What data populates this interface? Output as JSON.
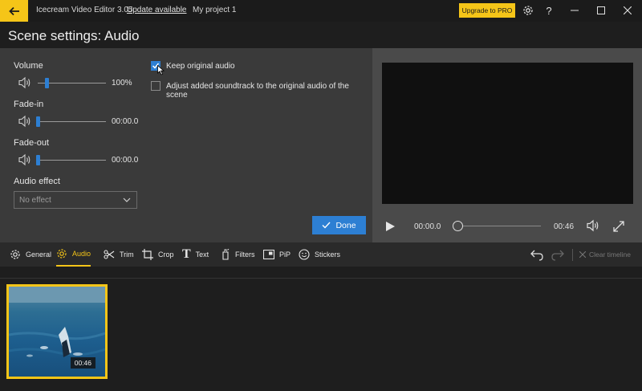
{
  "titlebar": {
    "app_title": "Icecream Video Editor 3.05",
    "update_link": "Update available",
    "project_name": "My project 1",
    "upgrade_label": "Upgrade to PRO"
  },
  "page_title": "Scene settings: Audio",
  "audio": {
    "volume_label": "Volume",
    "volume_value": "100%",
    "volume_level": 0.15,
    "fadein_label": "Fade-in",
    "fadein_value": "00:00.0",
    "fadeout_label": "Fade-out",
    "fadeout_value": "00:00.0",
    "effect_label": "Audio effect",
    "effect_value": "No effect",
    "keep_original_label": "Keep original audio",
    "keep_original_checked": true,
    "adjust_label": "Adjust added soundtrack to the original audio of the scene",
    "adjust_checked": false,
    "done_label": "Done"
  },
  "preview": {
    "current_time": "00:00.0",
    "duration": "00:46",
    "position": 0.0
  },
  "tools": [
    {
      "label": "General",
      "icon": "gear-icon"
    },
    {
      "label": "Audio",
      "icon": "gear-icon",
      "active": true
    },
    {
      "label": "Trim",
      "icon": "scissors-icon"
    },
    {
      "label": "Crop",
      "icon": "crop-icon"
    },
    {
      "label": "Text",
      "icon": "text-icon"
    },
    {
      "label": "Filters",
      "icon": "filters-icon"
    },
    {
      "label": "PiP",
      "icon": "pip-icon"
    },
    {
      "label": "Stickers",
      "icon": "smiley-icon"
    }
  ],
  "timeline": {
    "clear_label": "Clear timeline",
    "clip_duration": "00:46"
  },
  "colors": {
    "accent": "#f5c518",
    "primary": "#2d7fd3",
    "panel": "#3a3a3a",
    "background": "#1e1e1e"
  }
}
